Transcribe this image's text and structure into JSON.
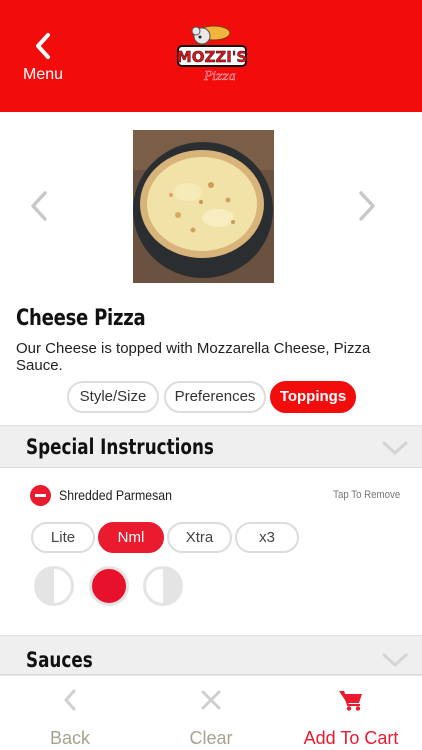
{
  "header": {
    "menu_label": "Menu",
    "logo_text": "MOZZI'S",
    "logo_subtext": "Pizza",
    "background_color": "#f20c0c"
  },
  "product": {
    "title": "Cheese Pizza",
    "description": "Our Cheese  is topped with Mozzarella Cheese, Pizza Sauce."
  },
  "tabs": [
    {
      "label": "Style/Size",
      "active": false
    },
    {
      "label": "Preferences",
      "active": false
    },
    {
      "label": "Toppings",
      "active": true
    }
  ],
  "sections": {
    "special_instructions": "Special Instructions",
    "sauces": "Sauces"
  },
  "topping": {
    "name": "Shredded Parmesan",
    "hint": "Tap To Remove",
    "amounts": [
      {
        "label": "Lite",
        "selected": false
      },
      {
        "label": "Nml",
        "selected": true
      },
      {
        "label": "Xtra",
        "selected": false
      },
      {
        "label": "x3",
        "selected": false
      }
    ],
    "portion_selected": "whole"
  },
  "bottom_bar": {
    "back_label": "Back",
    "clear_label": "Clear",
    "cart_label": "Add To Cart"
  },
  "colors": {
    "accent": "#ea1a2f",
    "muted_label": "#a6a390",
    "section_bg": "#efefef"
  },
  "icons": {
    "menu": "chevron-left-icon",
    "carousel_prev": "chevron-left-icon",
    "carousel_next": "chevron-right-icon",
    "section_toggle": "chevron-down-icon",
    "back": "chevron-left-icon",
    "clear": "close-icon",
    "cart": "cart-icon"
  }
}
